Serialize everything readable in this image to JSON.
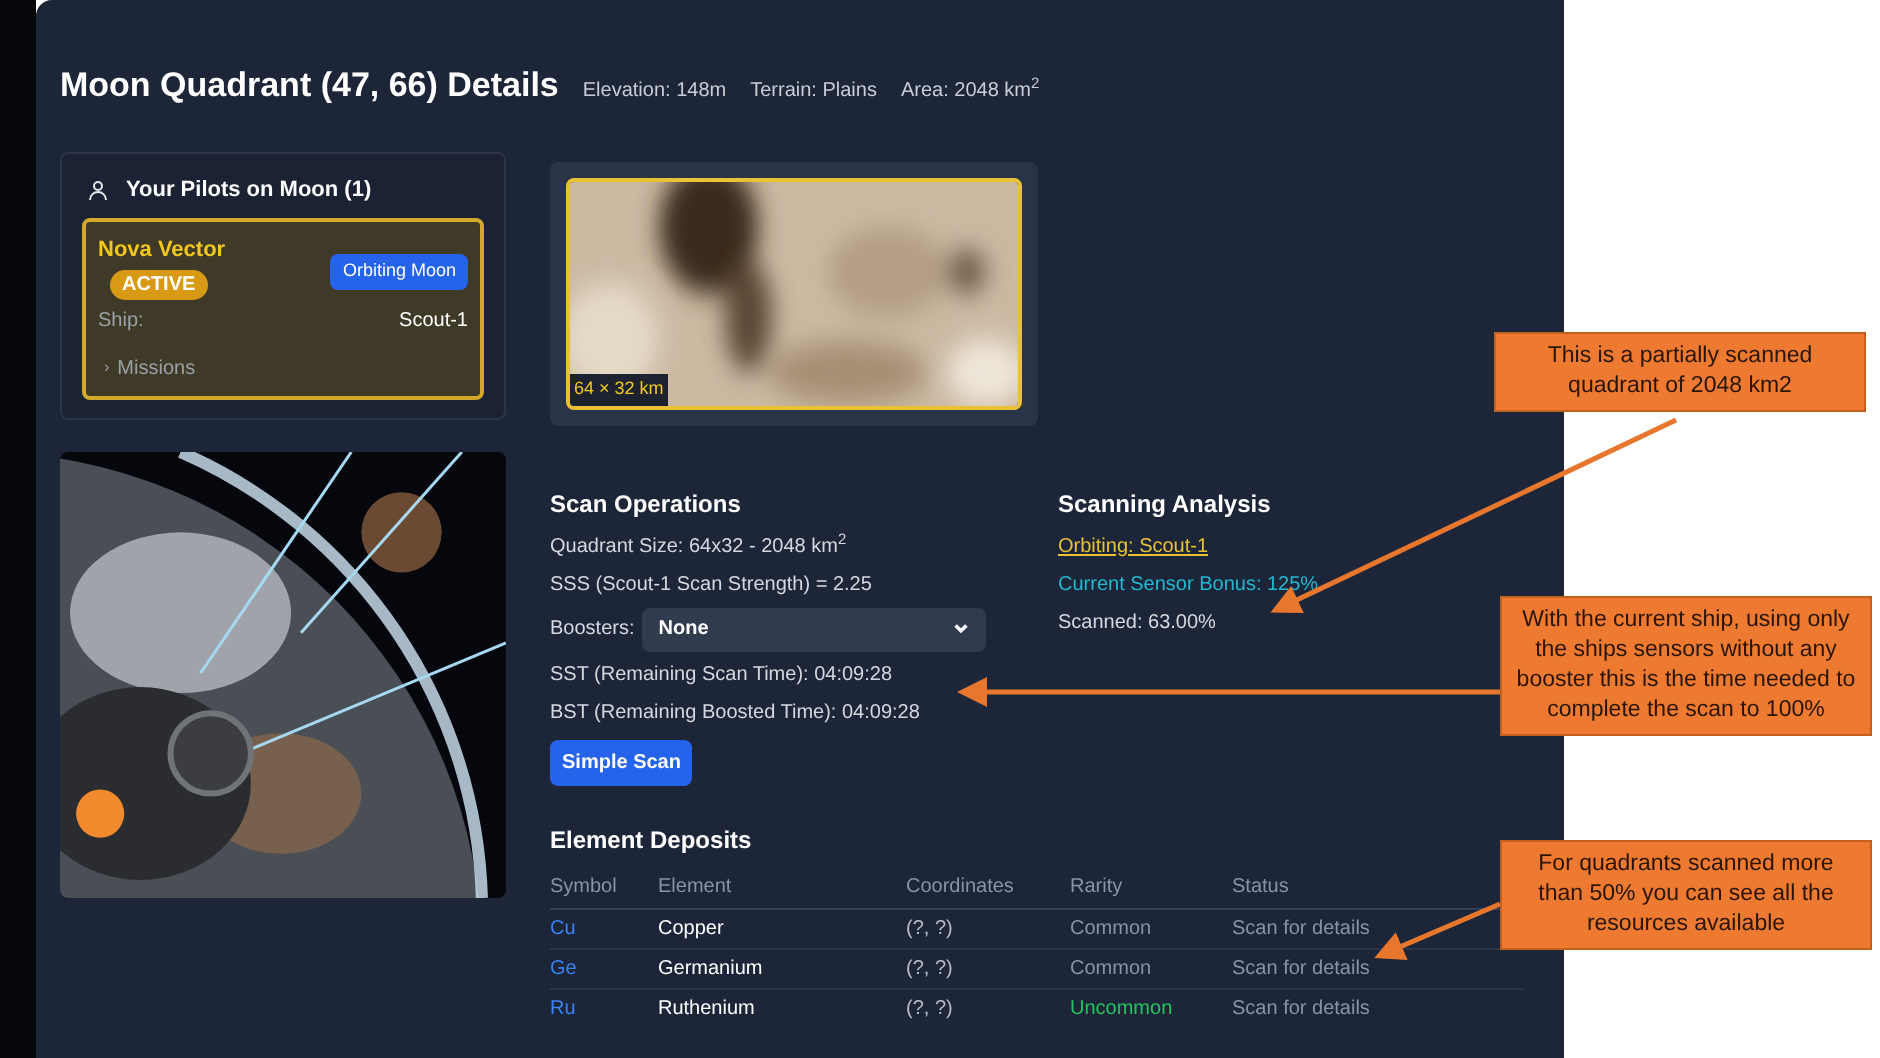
{
  "header": {
    "title": "Moon Quadrant (47, 66) Details",
    "stats": [
      "Elevation: 148m",
      "Terrain: Plains",
      "Area: 2048 km$^{2}$"
    ]
  },
  "pilots": {
    "title": "Your Pilots on Moon (1)",
    "items": [
      {
        "name": "Nova Vector",
        "status": "ACTIVE",
        "active": true,
        "badge": "Orbiting Moon",
        "ship_label": "Ship:",
        "ship": "Scout-1",
        "missions": "Missions",
        "chevron": "›",
        "expanded": false
      }
    ]
  },
  "map": {
    "kind": "picture",
    "label": "64 × 32 km"
  },
  "scan_operations": {
    "title": "Scan Operations",
    "lines": [
      "Quadrant Size: 64x32 - 2048 km$^{2}$",
      "SSS (Scout-1 Scan Strength) = 2.25"
    ],
    "boosters_label": "Boosters:",
    "boosters_value": "None",
    "times": [
      "SST (Remaining Scan Time): 04:09:28",
      "BST (Remaining Boosted Time): 04:09:28"
    ],
    "button": "Simple Scan"
  },
  "scanning_analysis": {
    "title": "Scanning Analysis",
    "orbiting": "Orbiting: Scout-1",
    "sensor_bonus": "Current Sensor Bonus: 125%",
    "scanned": "Scanned: 63.00%"
  },
  "deposits": {
    "title": "Element Deposits",
    "columns": [
      "Symbol",
      "Element",
      "Coordinates",
      "Rarity",
      "Status"
    ],
    "rows": [
      {
        "symbol": "Cu",
        "element": "Copper",
        "coordinates": "(?, ?)",
        "rarity": "Common",
        "color": "#8a93a3",
        "status": "Scan for details"
      },
      {
        "symbol": "Ge",
        "element": "Germanium",
        "coordinates": "(?, ?)",
        "rarity": "Common",
        "color": "#8a93a3",
        "status": "Scan for details"
      },
      {
        "symbol": "Ru",
        "element": "Ruthenium",
        "coordinates": "(?, ?)",
        "rarity": "Uncommon",
        "color": "#22c55e",
        "status": "Scan for details"
      }
    ]
  },
  "callouts": [
    "This is a partially scanned quadrant of 2048 km2",
    "With the current ship, using only the ships sensors without any booster this is the time needed to complete the scan to 100%",
    "For quadrants scanned more than 50% you can see all the resources available"
  ]
}
